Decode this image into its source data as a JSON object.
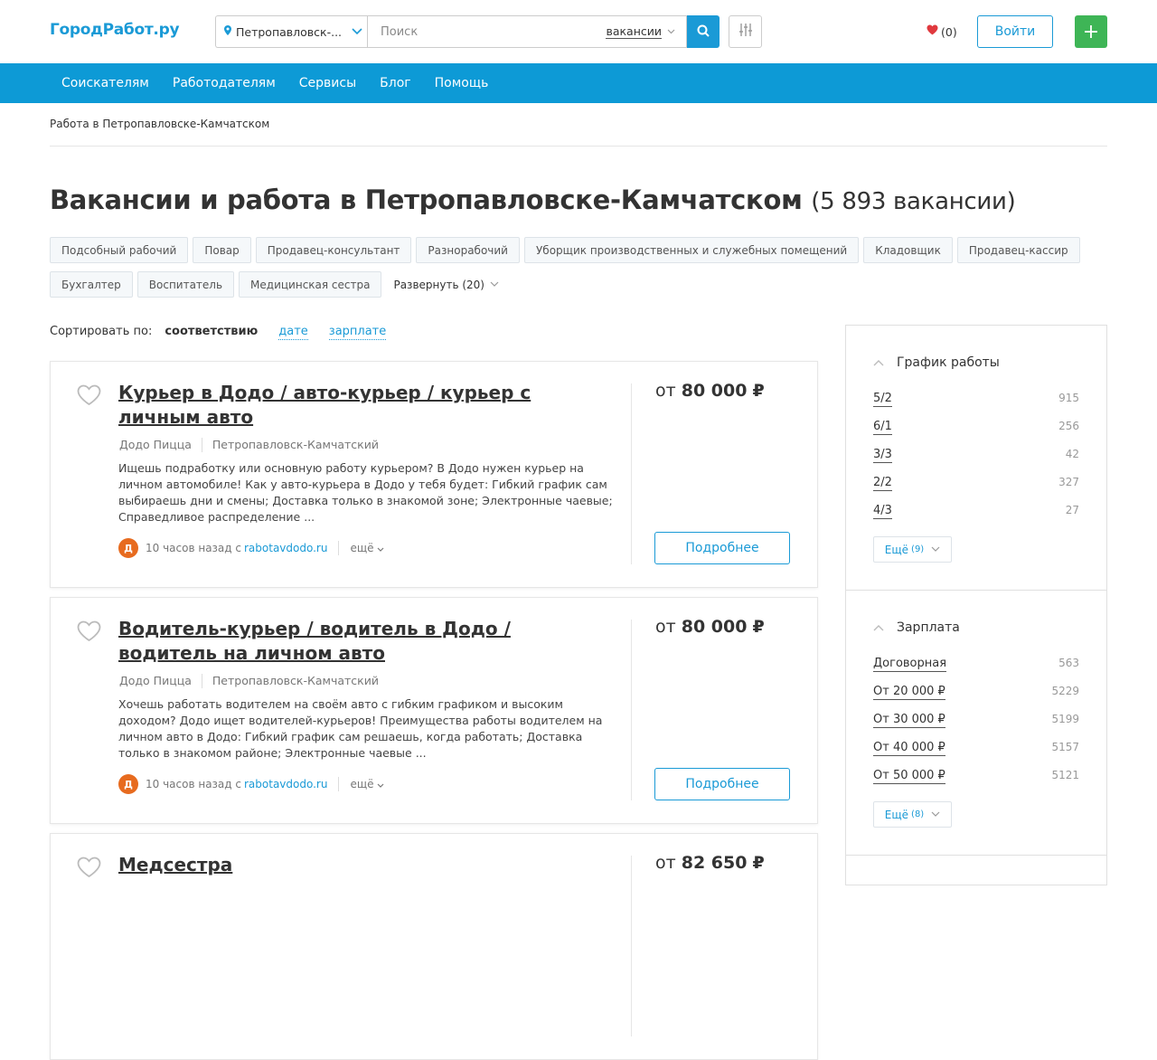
{
  "header": {
    "logo": "ГородРабот.ру",
    "city": "Петропавловск-...",
    "search_placeholder": "Поиск",
    "search_type": "вакансии",
    "favorites_count": "(0)",
    "login_label": "Войти",
    "add_label": "+"
  },
  "nav": [
    "Соискателям",
    "Работодателям",
    "Сервисы",
    "Блог",
    "Помощь"
  ],
  "breadcrumb": "Работа в Петропавловске-Камчатском",
  "page_title": "Вакансии и работа в Петропавловске-Камчатском",
  "page_count": "(5 893 вакансии)",
  "tags": [
    "Подсобный рабочий",
    "Повар",
    "Продавец-консультант",
    "Разнорабочий",
    "Уборщик производственных и служебных помещений",
    "Кладовщик",
    "Продавец-кассир",
    "Бухгалтер",
    "Воспитатель",
    "Медицинская сестра"
  ],
  "tags_more": "Развернуть (20)",
  "sort": {
    "label": "Сортировать по:",
    "active": "соответствию",
    "options": [
      "дате",
      "зарплате"
    ]
  },
  "vacancies": [
    {
      "title": "Курьер в Додо / авто-курьер / курьер с личным авто",
      "company": "Додо Пицца",
      "city": "Петропавловск-Камчатский",
      "description": "Ищешь подработку или основную работу курьером? В Додо нужен курьер на личном автомобиле! Как у авто-курьера в Додо у тебя будет: Гибкий график сам выбираешь дни и смены; Доставка только в знакомой зоне; Электронные чаевые; Справедливое распределение ...",
      "time": "10 часов назад с",
      "source": "rabotavdodo.ru",
      "more": "ещё",
      "salary_prefix": "от",
      "salary": "80 000",
      "currency": "₽",
      "button": "Подробнее"
    },
    {
      "title": "Водитель-курьер / водитель в Додо / водитель на личном авто",
      "company": "Додо Пицца",
      "city": "Петропавловск-Камчатский",
      "description": "Хочешь работать водителем на своём авто с гибким графиком и высоким доходом? Додо ищет водителей-курьеров! Преимущества работы водителем на личном авто в Додо: Гибкий график сам решаешь, когда работать; Доставка только в знакомом районе; Электронные чаевые ...",
      "time": "10 часов назад с",
      "source": "rabotavdodo.ru",
      "more": "ещё",
      "salary_prefix": "от",
      "salary": "80 000",
      "currency": "₽",
      "button": "Подробнее"
    },
    {
      "title": "Медсестра",
      "salary_prefix": "от",
      "salary": "82 650",
      "currency": "₽"
    }
  ],
  "sidebar": {
    "schedule": {
      "title": "График работы",
      "items": [
        {
          "label": "5/2",
          "count": "915"
        },
        {
          "label": "6/1",
          "count": "256"
        },
        {
          "label": "3/3",
          "count": "42"
        },
        {
          "label": "2/2",
          "count": "327"
        },
        {
          "label": "4/3",
          "count": "27"
        }
      ],
      "more": "Ещё",
      "more_count": "(9)"
    },
    "salary": {
      "title": "Зарплата",
      "items": [
        {
          "label": "Договорная",
          "count": "563"
        },
        {
          "label": "От 20 000 ₽",
          "count": "5229"
        },
        {
          "label": "От 30 000 ₽",
          "count": "5199"
        },
        {
          "label": "От 40 000 ₽",
          "count": "5157"
        },
        {
          "label": "От 50 000 ₽",
          "count": "5121"
        }
      ],
      "more": "Ещё",
      "more_count": "(8)"
    }
  },
  "colors": {
    "brand": "#1a9ad6",
    "nav_bg": "#0d9ad6",
    "add_button": "#3eb556",
    "heart": "#e0393e"
  }
}
